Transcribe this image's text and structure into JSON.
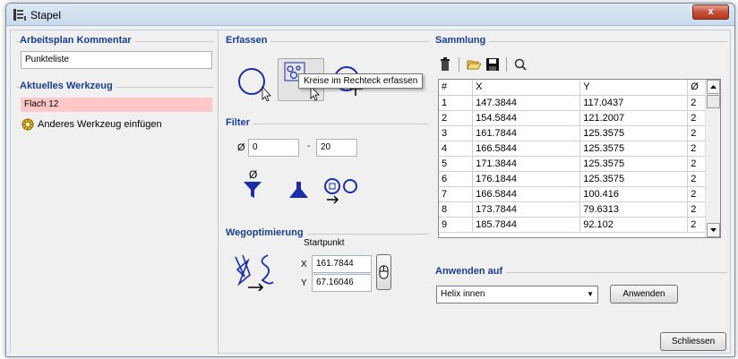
{
  "window": {
    "title": "Stapel",
    "close_label": "x"
  },
  "left": {
    "kommentar_title": "Arbeitsplan Kommentar",
    "kommentar_value": "Punkteliste",
    "werkzeug_title": "Aktuelles Werkzeug",
    "werkzeug_value": "Flach 12",
    "insert_tool_label": "Anderes Werkzeug einfügen"
  },
  "erfassen": {
    "title": "Erfassen",
    "tools": [
      "circle-capture-icon",
      "rect-circles-capture-icon",
      "face-capture-icon"
    ],
    "tooltip": "Kreise im Rechteck erfassen"
  },
  "filter": {
    "title": "Filter",
    "diameter_symbol": "Ø",
    "min_value": "0",
    "range_separator": "-",
    "max_value": "20"
  },
  "wegoptimierung": {
    "title": "Wegoptimierung",
    "startpunkt_label": "Startpunkt",
    "x_label": "X",
    "x_value": "161.7844",
    "y_label": "Y",
    "y_value": "67.16046"
  },
  "sammlung": {
    "title": "Sammlung",
    "columns": [
      "#",
      "X",
      "Y",
      "Ø"
    ],
    "rows": [
      [
        "1",
        "147.3844",
        "117.0437",
        "2"
      ],
      [
        "2",
        "154.5844",
        "121.2007",
        "2"
      ],
      [
        "3",
        "161.7844",
        "125.3575",
        "2"
      ],
      [
        "4",
        "166.5844",
        "125.3575",
        "2"
      ],
      [
        "5",
        "171.3844",
        "125.3575",
        "2"
      ],
      [
        "6",
        "176.1844",
        "125.3575",
        "2"
      ],
      [
        "7",
        "166.5844",
        "100.416",
        "2"
      ],
      [
        "8",
        "173.7844",
        "79.6313",
        "2"
      ],
      [
        "9",
        "185.7844",
        "92.102",
        "2"
      ]
    ]
  },
  "anwenden": {
    "title": "Anwenden auf",
    "selected": "Helix innen",
    "button_label": "Anwenden"
  },
  "footer": {
    "close_button_label": "Schliessen"
  }
}
